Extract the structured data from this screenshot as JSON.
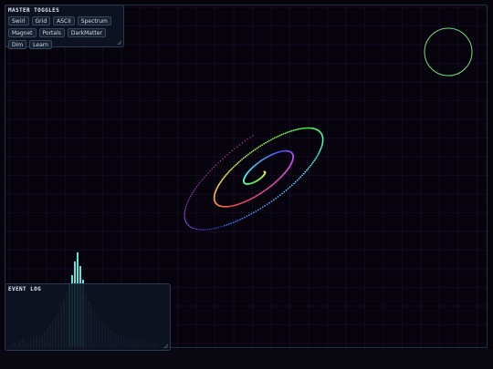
{
  "toggles": {
    "title": "MASTER TOGGLES",
    "buttons": [
      "Swirl",
      "Grid",
      "ASCII",
      "Spectrum",
      "Magnet",
      "Portals",
      "DarkMatter",
      "Dim",
      "Learn"
    ]
  },
  "log": {
    "title": "EVENT LOG"
  },
  "colors": {
    "background": "#07030d",
    "grid": "#1a1130",
    "frame": "#1c3342",
    "panel": "#0e1422",
    "spectrum_bar": "#5fe0d8",
    "portal_ring": "#6ee07a"
  },
  "icons": {
    "resize_handle": "resize-grip-icon"
  }
}
